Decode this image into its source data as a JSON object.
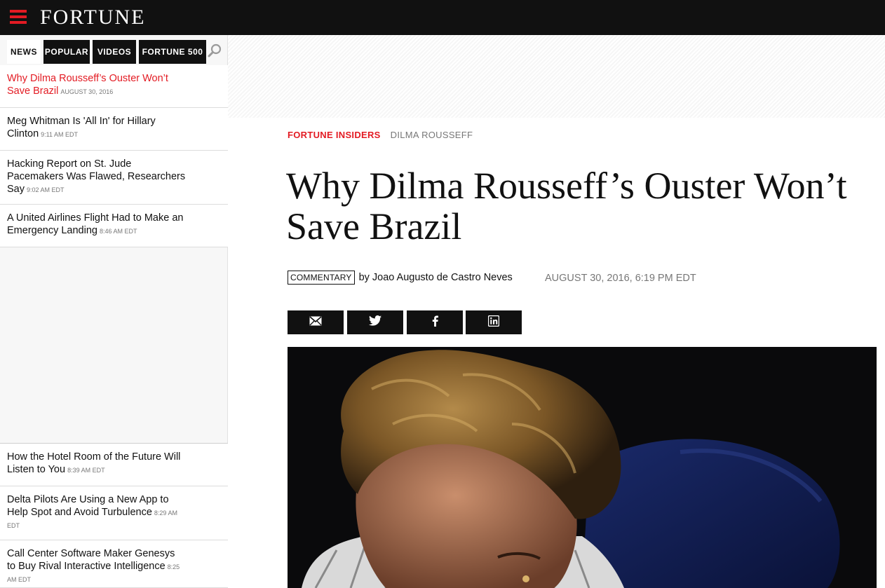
{
  "header": {
    "logo": "FORTUNE"
  },
  "sidebar": {
    "tabs": [
      {
        "label": "NEWS"
      },
      {
        "label": "POPULAR"
      },
      {
        "label": "VIDEOS"
      },
      {
        "label": "FORTUNE 500"
      }
    ],
    "top_items": [
      {
        "headline": "Why Dilma Rousseff’s Ouster Won’t Save Brazil",
        "time": "AUGUST 30, 2016"
      },
      {
        "headline": "Meg Whitman Is 'All In' for Hillary Clinton",
        "time": "9:11 AM EDT"
      },
      {
        "headline": "Hacking Report on St. Jude Pacemakers Was Flawed, Researchers Say",
        "time": "9:02 AM EDT"
      },
      {
        "headline": "A United Airlines Flight Had to Make an Emergency Landing",
        "time": "8:46 AM EDT"
      }
    ],
    "bottom_items": [
      {
        "headline": "How the Hotel Room of the Future Will Listen to You",
        "time": "8:39 AM EDT"
      },
      {
        "headline": "Delta Pilots Are Using a New App to Help Spot and Avoid Turbulence",
        "time": "8:29 AM EDT"
      },
      {
        "headline": "Call Center Software Maker Genesys to Buy Rival Interactive Intelligence",
        "time": "8:25 AM EDT"
      }
    ]
  },
  "article": {
    "crumb_primary": "FORTUNE INSIDERS",
    "crumb_secondary": "DILMA ROUSSEFF",
    "headline": "Why Dilma Rousseff’s Ouster Won’t Save Brazil",
    "tag": "COMMENTARY",
    "by": "by",
    "author": "Joao Augusto de Castro Neves",
    "date": "AUGUST 30, 2016, 6:19 PM EDT",
    "share_icons": [
      "email-icon",
      "twitter-icon",
      "facebook-icon",
      "linkedin-icon"
    ]
  },
  "colors": {
    "accent": "#e31b23",
    "bar": "#111111"
  }
}
